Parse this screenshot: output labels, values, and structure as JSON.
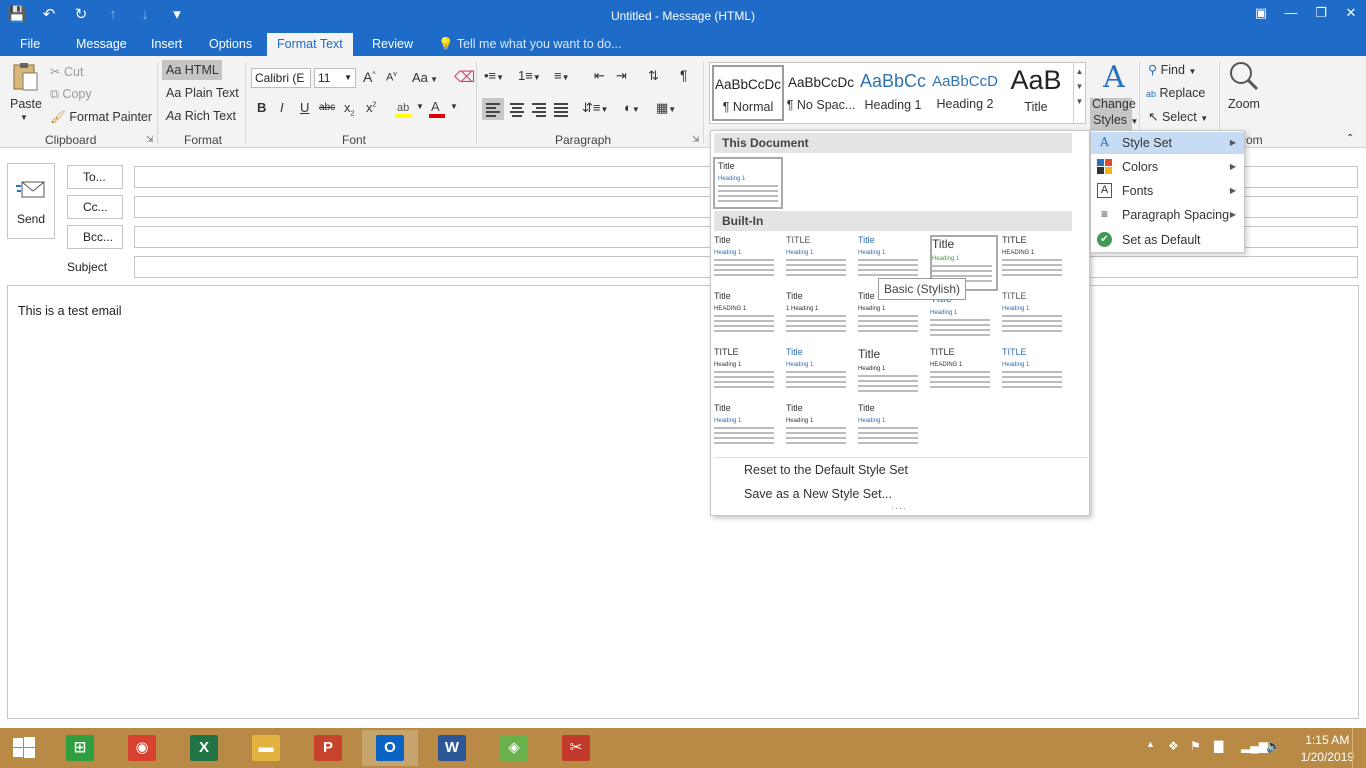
{
  "window": {
    "title": "Untitled - Message (HTML)",
    "qat": {
      "save_icon": "floppy-disk-icon",
      "undo_icon": "undo-icon",
      "redo_icon": "redo-icon",
      "up_icon": "arrow-up-icon",
      "down_icon": "arrow-down-icon",
      "customize_icon": "customize-qat-icon"
    },
    "controls": {
      "ribbon_display": "▣",
      "minimize": "—",
      "restore": "❐",
      "close": "✕"
    }
  },
  "tabs": [
    {
      "label": "File",
      "active": false
    },
    {
      "label": "Message",
      "active": false
    },
    {
      "label": "Insert",
      "active": false
    },
    {
      "label": "Options",
      "active": false
    },
    {
      "label": "Format Text",
      "active": true
    },
    {
      "label": "Review",
      "active": false
    }
  ],
  "tell_me": {
    "placeholder": "Tell me what you want to do..."
  },
  "ribbon": {
    "clipboard": {
      "group_label": "Clipboard",
      "paste": "Paste",
      "cut": "Cut",
      "copy": "Copy",
      "format_painter": "Format Painter"
    },
    "format": {
      "group_label": "Format",
      "html": "HTML",
      "plain_text": "Plain Text",
      "rich_text": "Rich Text",
      "aa": "Aa"
    },
    "font": {
      "group_label": "Font",
      "font_name": "Calibri (E",
      "font_size": "11",
      "grow": "A",
      "shrink": "A",
      "change_case": "Aa",
      "bold": "B",
      "italic": "I",
      "underline": "U",
      "strike": "abc",
      "subscript": "x",
      "superscript": "x",
      "highlight_color": "#ffff00",
      "font_color": "#e00000"
    },
    "paragraph": {
      "group_label": "Paragraph",
      "pilcrow": "¶"
    },
    "styles": {
      "gallery": [
        {
          "preview": "AaBbCcDc",
          "name": "¶ Normal",
          "selected": true,
          "color": "#222222",
          "size": "13.5px"
        },
        {
          "preview": "AaBbCcDc",
          "name": "¶ No Spac...",
          "selected": false,
          "color": "#222222",
          "size": "13.5px"
        },
        {
          "preview": "AaBbCc",
          "name": "Heading 1",
          "selected": false,
          "color": "#2e74b5",
          "size": "18px"
        },
        {
          "preview": "AaBbCcD",
          "name": "Heading 2",
          "selected": false,
          "color": "#2e74b5",
          "size": "15px"
        },
        {
          "preview": "AaB",
          "name": "Title",
          "selected": false,
          "color": "#222222",
          "size": "27px"
        }
      ],
      "change_styles": "Change",
      "change_styles_2": "Styles"
    },
    "editing": {
      "find": "Find",
      "replace": "Replace",
      "select": "Select"
    },
    "zoom": {
      "label": "Zoom",
      "group_tail": "om"
    }
  },
  "compose": {
    "send": "Send",
    "to": "To...",
    "cc": "Cc...",
    "bcc": "Bcc...",
    "subject_label": "Subject",
    "body": "This is a test email"
  },
  "style_set_menu": {
    "this_document": "This Document",
    "built_in": "Built-In",
    "thumbs": [
      {
        "title": "Title",
        "heading": "Heading 1",
        "tcolor": "#333333",
        "hcolor": "#2f6fb5"
      },
      {
        "title": "TITLE",
        "heading": "Heading 1",
        "tcolor": "#555555",
        "hcolor": "#2f6fb5"
      },
      {
        "title": "Title",
        "heading": "Heading 1",
        "tcolor": "#2f6fb5",
        "hcolor": "#2f6fb5"
      },
      {
        "title": "Title",
        "heading": "Heading 1",
        "tcolor": "#333333",
        "hcolor": "#3b9a3b"
      },
      {
        "title": "TITLE",
        "heading": "HEADING 1",
        "tcolor": "#333333",
        "hcolor": "#333333"
      },
      {
        "title": "Title",
        "heading": "HEADING 1",
        "tcolor": "#333333",
        "hcolor": "#333333"
      },
      {
        "title": "Title",
        "heading": "1 Heading 1",
        "tcolor": "#333333",
        "hcolor": "#333333"
      },
      {
        "title": "Title",
        "heading": "Heading 1",
        "tcolor": "#333333",
        "hcolor": "#333333"
      },
      {
        "title": "Title",
        "heading": "Heading 1",
        "tcolor": "#2f6fb5",
        "hcolor": "#2f6fb5"
      },
      {
        "title": "TITLE",
        "heading": "Heading 1",
        "tcolor": "#555555",
        "hcolor": "#2f6fb5"
      },
      {
        "title": "TITLE",
        "heading": "Heading 1",
        "tcolor": "#333333",
        "hcolor": "#333333"
      },
      {
        "title": "Title",
        "heading": "Heading 1",
        "tcolor": "#2f6fb5",
        "hcolor": "#2f6fb5"
      },
      {
        "title": "Title",
        "heading": "Heading 1",
        "tcolor": "#333333",
        "hcolor": "#333333"
      },
      {
        "title": "TITLE",
        "heading": "HEADING 1",
        "tcolor": "#333333",
        "hcolor": "#333333"
      },
      {
        "title": "TITLE",
        "heading": "Heading 1",
        "tcolor": "#2f6fb5",
        "hcolor": "#2f6fb5"
      },
      {
        "title": "Title",
        "heading": "Heading 1",
        "tcolor": "#333333",
        "hcolor": "#2f6fb5"
      },
      {
        "title": "Title",
        "heading": "Heading 1",
        "tcolor": "#333333",
        "hcolor": "#333333"
      },
      {
        "title": "Title",
        "heading": "Heading 1",
        "tcolor": "#333333",
        "hcolor": "#2f6fb5"
      }
    ],
    "tooltip": "Basic (Stylish)",
    "reset": "Reset to the Default Style Set",
    "save_new": "Save as a New Style Set..."
  },
  "change_styles_menu": {
    "items": [
      {
        "label": "Style Set",
        "icon": "A",
        "arrow": "▶"
      },
      {
        "label": "Colors",
        "icon": "■",
        "arrow": "▶"
      },
      {
        "label": "Fonts",
        "icon": "A",
        "arrow": "▶"
      },
      {
        "label": "Paragraph Spacing",
        "icon": "≡",
        "arrow": "▶"
      },
      {
        "label": "Set as Default",
        "icon": "✔",
        "arrow": ""
      }
    ]
  },
  "taskbar": {
    "apps": [
      {
        "name": "Store",
        "glyph": "⊞",
        "color": "#2e9e3f"
      },
      {
        "name": "Chrome",
        "glyph": "◉",
        "color": "#d8402f"
      },
      {
        "name": "Excel",
        "glyph": "X",
        "color": "#217346"
      },
      {
        "name": "File Explorer",
        "glyph": "▬",
        "color": "#e3b341"
      },
      {
        "name": "PowerPoint",
        "glyph": "P",
        "color": "#c8432b"
      },
      {
        "name": "Outlook",
        "glyph": "O",
        "color": "#0a64c4"
      },
      {
        "name": "Word",
        "glyph": "W",
        "color": "#2b5797"
      },
      {
        "name": "Maps",
        "glyph": "◈",
        "color": "#6ab04c"
      },
      {
        "name": "Snipping Tool",
        "glyph": "✂",
        "color": "#c0392b"
      }
    ],
    "time": "1:15 AM",
    "date": "1/20/2019"
  }
}
